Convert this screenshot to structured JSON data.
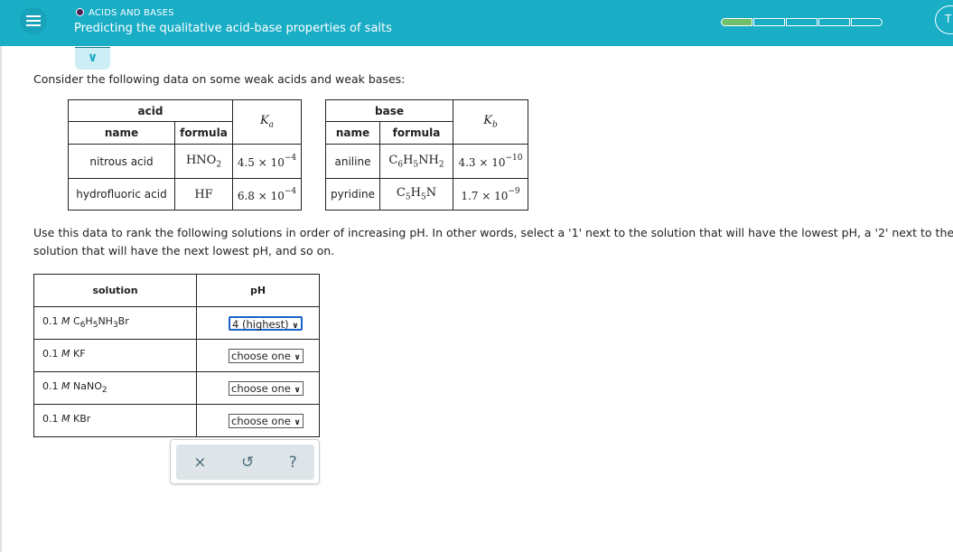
{
  "header": {
    "topic": "ACIDS AND BASES",
    "title": "Predicting the qualitative acid-base properties of salts",
    "progress": {
      "segments": 5,
      "filled": 1,
      "fill_color": "#6fbf6a"
    },
    "avatar_initial": "T",
    "bg_color": "#19adc6"
  },
  "intro": "Consider the following data on some weak acids and weak bases:",
  "acid_table": {
    "group": "acid",
    "name_h": "name",
    "formula_h": "formula",
    "k_symbol": "K",
    "k_sub": "a",
    "rows": [
      {
        "name": "nitrous acid",
        "f": [
          "HNO",
          "2"
        ],
        "k": "4.5 × 10",
        "exp": "−4"
      },
      {
        "name": "hydrofluoric acid",
        "f": [
          "HF",
          ""
        ],
        "k": "6.8 × 10",
        "exp": "−4"
      }
    ]
  },
  "base_table": {
    "group": "base",
    "name_h": "name",
    "formula_h": "formula",
    "k_symbol": "K",
    "k_sub": "b",
    "rows": [
      {
        "name": "aniline",
        "f": [
          "C",
          "6",
          "H",
          "5",
          "NH",
          "2"
        ],
        "k": "4.3 × 10",
        "exp": "−10"
      },
      {
        "name": "pyridine",
        "f": [
          "C",
          "5",
          "H",
          "5",
          "N",
          ""
        ],
        "k": "1.7 × 10",
        "exp": "−9"
      }
    ]
  },
  "instructions": "Use this data to rank the following solutions in order of increasing pH. In other words, select a '1' next to the solution that will have the lowest pH, a '2' next to the solution that will have the next lowest pH, and so on.",
  "solutions": {
    "col_solution": "solution",
    "col_ph": "pH",
    "conc": "0.1",
    "unit": "M",
    "rows": [
      {
        "f": [
          "C",
          "6",
          "H",
          "5",
          "NH",
          "3",
          "Br"
        ],
        "ph": "4 (highest)"
      },
      {
        "f": [
          "KF",
          "",
          "",
          "",
          "",
          "",
          ""
        ],
        "ph": "choose one"
      },
      {
        "f": [
          "NaNO",
          "2",
          "",
          "",
          "",
          "",
          ""
        ],
        "ph": "choose one"
      },
      {
        "f": [
          "KBr",
          "",
          "",
          "",
          "",
          "",
          ""
        ],
        "ph": "choose one"
      }
    ]
  },
  "actions": {
    "clear": "×",
    "undo": "↺",
    "help": "?"
  }
}
